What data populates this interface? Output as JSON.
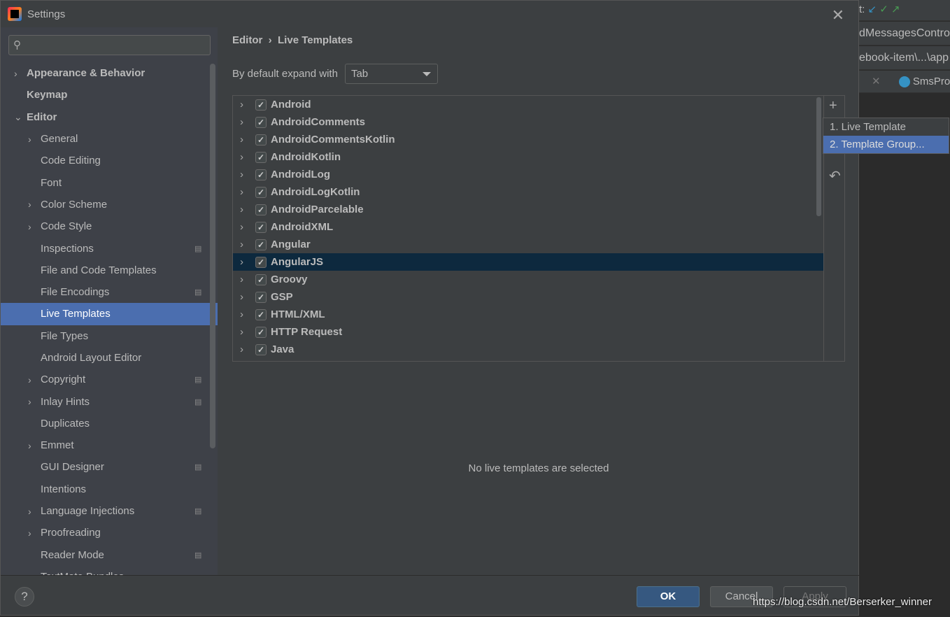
{
  "window": {
    "title": "Settings"
  },
  "ide_background": {
    "toolbar_label": "t:",
    "file_tab": "dMessagesContro",
    "path": "ebook-item\\...\\app",
    "editor_tab": "SmsPro"
  },
  "sidebar": {
    "search_placeholder": "",
    "items": [
      {
        "label": "Appearance & Behavior",
        "level": 0,
        "expandable": true,
        "bold": true
      },
      {
        "label": "Keymap",
        "level": 0,
        "bold": true
      },
      {
        "label": "Editor",
        "level": 0,
        "expanded": true,
        "bold": true
      },
      {
        "label": "General",
        "level": 1,
        "expandable": true
      },
      {
        "label": "Code Editing",
        "level": 1
      },
      {
        "label": "Font",
        "level": 1
      },
      {
        "label": "Color Scheme",
        "level": 1,
        "expandable": true
      },
      {
        "label": "Code Style",
        "level": 1,
        "expandable": true
      },
      {
        "label": "Inspections",
        "level": 1,
        "project": true
      },
      {
        "label": "File and Code Templates",
        "level": 1
      },
      {
        "label": "File Encodings",
        "level": 1,
        "project": true
      },
      {
        "label": "Live Templates",
        "level": 1,
        "selected": true
      },
      {
        "label": "File Types",
        "level": 1
      },
      {
        "label": "Android Layout Editor",
        "level": 1
      },
      {
        "label": "Copyright",
        "level": 1,
        "expandable": true,
        "project": true
      },
      {
        "label": "Inlay Hints",
        "level": 1,
        "expandable": true,
        "project": true
      },
      {
        "label": "Duplicates",
        "level": 1
      },
      {
        "label": "Emmet",
        "level": 1,
        "expandable": true
      },
      {
        "label": "GUI Designer",
        "level": 1,
        "project": true
      },
      {
        "label": "Intentions",
        "level": 1
      },
      {
        "label": "Language Injections",
        "level": 1,
        "expandable": true,
        "project": true
      },
      {
        "label": "Proofreading",
        "level": 1,
        "expandable": true
      },
      {
        "label": "Reader Mode",
        "level": 1,
        "project": true
      },
      {
        "label": "TextMate Bundles",
        "level": 1
      }
    ]
  },
  "main": {
    "breadcrumb": [
      "Editor",
      "Live Templates"
    ],
    "expand_label": "By default expand with",
    "expand_value": "Tab",
    "groups": [
      {
        "label": "Android",
        "checked": true
      },
      {
        "label": "AndroidComments",
        "checked": true
      },
      {
        "label": "AndroidCommentsKotlin",
        "checked": true
      },
      {
        "label": "AndroidKotlin",
        "checked": true
      },
      {
        "label": "AndroidLog",
        "checked": true
      },
      {
        "label": "AndroidLogKotlin",
        "checked": true
      },
      {
        "label": "AndroidParcelable",
        "checked": true
      },
      {
        "label": "AndroidXML",
        "checked": true
      },
      {
        "label": "Angular",
        "checked": true
      },
      {
        "label": "AngularJS",
        "checked": true,
        "selected": true
      },
      {
        "label": "Groovy",
        "checked": true
      },
      {
        "label": "GSP",
        "checked": true
      },
      {
        "label": "HTML/XML",
        "checked": true
      },
      {
        "label": "HTTP Request",
        "checked": true
      },
      {
        "label": "Java",
        "checked": true
      }
    ],
    "empty_message": "No live templates are selected",
    "popup": [
      {
        "label": "1. Live Template"
      },
      {
        "label": "2. Template Group...",
        "highlighted": true
      }
    ]
  },
  "footer": {
    "help": "?",
    "ok": "OK",
    "cancel": "Cancel",
    "apply": "Apply"
  },
  "watermark": "https://blog.csdn.net/Berserker_winner",
  "colors": {
    "selection": "#4b6eaf",
    "row_selection": "#0d293e",
    "ok_button": "#365880"
  }
}
